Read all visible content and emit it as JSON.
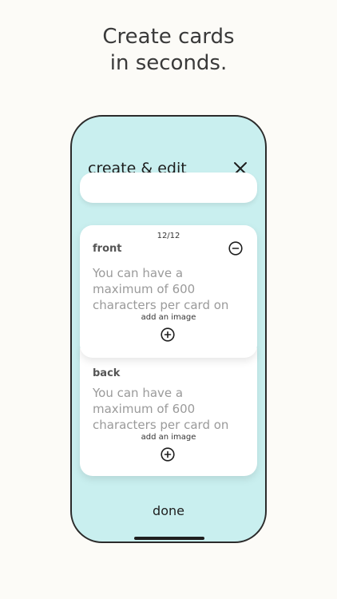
{
  "promo": {
    "line1": "Create cards",
    "line2": "in seconds."
  },
  "screen": {
    "title": "create & edit",
    "close_icon": "close-icon",
    "counter": "12/12",
    "front": {
      "label": "front",
      "placeholder": "You can have a maximum of 600 characters per card on",
      "add_image_label": "add an image"
    },
    "back": {
      "label": "back",
      "placeholder": "You can have a maximum of 600 characters per card on",
      "add_image_label": "add an image"
    },
    "done_label": "done"
  },
  "colors": {
    "background": "#fcfbf7",
    "phone_screen": "#c9efef",
    "card": "#ffffff",
    "text": "#1e1e1e",
    "placeholder": "#9a9a9a"
  }
}
